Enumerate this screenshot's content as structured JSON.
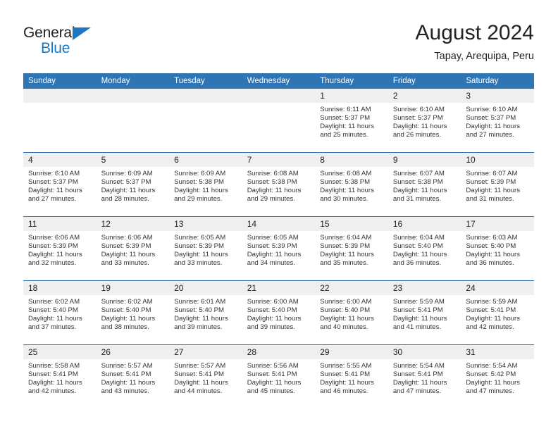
{
  "brand": {
    "name_top": "General",
    "name_bottom": "Blue",
    "triangle_color": "#1b77c4"
  },
  "header": {
    "title": "August 2024",
    "subtitle": "Tapay, Arequipa, Peru"
  },
  "theme": {
    "header_blue": "#2e75b6",
    "daynum_band": "#efefef",
    "text": "#222222"
  },
  "calendar": {
    "weekday_headers": [
      "Sunday",
      "Monday",
      "Tuesday",
      "Wednesday",
      "Thursday",
      "Friday",
      "Saturday"
    ],
    "weeks": [
      [
        {
          "day": "",
          "blank": true,
          "sunrise": "",
          "sunset": "",
          "daylight1": "",
          "daylight2": ""
        },
        {
          "day": "",
          "blank": true,
          "sunrise": "",
          "sunset": "",
          "daylight1": "",
          "daylight2": ""
        },
        {
          "day": "",
          "blank": true,
          "sunrise": "",
          "sunset": "",
          "daylight1": "",
          "daylight2": ""
        },
        {
          "day": "",
          "blank": true,
          "sunrise": "",
          "sunset": "",
          "daylight1": "",
          "daylight2": ""
        },
        {
          "day": "1",
          "blank": false,
          "sunrise": "Sunrise: 6:11 AM",
          "sunset": "Sunset: 5:37 PM",
          "daylight1": "Daylight: 11 hours",
          "daylight2": "and 25 minutes."
        },
        {
          "day": "2",
          "blank": false,
          "sunrise": "Sunrise: 6:10 AM",
          "sunset": "Sunset: 5:37 PM",
          "daylight1": "Daylight: 11 hours",
          "daylight2": "and 26 minutes."
        },
        {
          "day": "3",
          "blank": false,
          "sunrise": "Sunrise: 6:10 AM",
          "sunset": "Sunset: 5:37 PM",
          "daylight1": "Daylight: 11 hours",
          "daylight2": "and 27 minutes."
        }
      ],
      [
        {
          "day": "4",
          "blank": false,
          "sunrise": "Sunrise: 6:10 AM",
          "sunset": "Sunset: 5:37 PM",
          "daylight1": "Daylight: 11 hours",
          "daylight2": "and 27 minutes."
        },
        {
          "day": "5",
          "blank": false,
          "sunrise": "Sunrise: 6:09 AM",
          "sunset": "Sunset: 5:37 PM",
          "daylight1": "Daylight: 11 hours",
          "daylight2": "and 28 minutes."
        },
        {
          "day": "6",
          "blank": false,
          "sunrise": "Sunrise: 6:09 AM",
          "sunset": "Sunset: 5:38 PM",
          "daylight1": "Daylight: 11 hours",
          "daylight2": "and 29 minutes."
        },
        {
          "day": "7",
          "blank": false,
          "sunrise": "Sunrise: 6:08 AM",
          "sunset": "Sunset: 5:38 PM",
          "daylight1": "Daylight: 11 hours",
          "daylight2": "and 29 minutes."
        },
        {
          "day": "8",
          "blank": false,
          "sunrise": "Sunrise: 6:08 AM",
          "sunset": "Sunset: 5:38 PM",
          "daylight1": "Daylight: 11 hours",
          "daylight2": "and 30 minutes."
        },
        {
          "day": "9",
          "blank": false,
          "sunrise": "Sunrise: 6:07 AM",
          "sunset": "Sunset: 5:38 PM",
          "daylight1": "Daylight: 11 hours",
          "daylight2": "and 31 minutes."
        },
        {
          "day": "10",
          "blank": false,
          "sunrise": "Sunrise: 6:07 AM",
          "sunset": "Sunset: 5:39 PM",
          "daylight1": "Daylight: 11 hours",
          "daylight2": "and 31 minutes."
        }
      ],
      [
        {
          "day": "11",
          "blank": false,
          "sunrise": "Sunrise: 6:06 AM",
          "sunset": "Sunset: 5:39 PM",
          "daylight1": "Daylight: 11 hours",
          "daylight2": "and 32 minutes."
        },
        {
          "day": "12",
          "blank": false,
          "sunrise": "Sunrise: 6:06 AM",
          "sunset": "Sunset: 5:39 PM",
          "daylight1": "Daylight: 11 hours",
          "daylight2": "and 33 minutes."
        },
        {
          "day": "13",
          "blank": false,
          "sunrise": "Sunrise: 6:05 AM",
          "sunset": "Sunset: 5:39 PM",
          "daylight1": "Daylight: 11 hours",
          "daylight2": "and 33 minutes."
        },
        {
          "day": "14",
          "blank": false,
          "sunrise": "Sunrise: 6:05 AM",
          "sunset": "Sunset: 5:39 PM",
          "daylight1": "Daylight: 11 hours",
          "daylight2": "and 34 minutes."
        },
        {
          "day": "15",
          "blank": false,
          "sunrise": "Sunrise: 6:04 AM",
          "sunset": "Sunset: 5:39 PM",
          "daylight1": "Daylight: 11 hours",
          "daylight2": "and 35 minutes."
        },
        {
          "day": "16",
          "blank": false,
          "sunrise": "Sunrise: 6:04 AM",
          "sunset": "Sunset: 5:40 PM",
          "daylight1": "Daylight: 11 hours",
          "daylight2": "and 36 minutes."
        },
        {
          "day": "17",
          "blank": false,
          "sunrise": "Sunrise: 6:03 AM",
          "sunset": "Sunset: 5:40 PM",
          "daylight1": "Daylight: 11 hours",
          "daylight2": "and 36 minutes."
        }
      ],
      [
        {
          "day": "18",
          "blank": false,
          "sunrise": "Sunrise: 6:02 AM",
          "sunset": "Sunset: 5:40 PM",
          "daylight1": "Daylight: 11 hours",
          "daylight2": "and 37 minutes."
        },
        {
          "day": "19",
          "blank": false,
          "sunrise": "Sunrise: 6:02 AM",
          "sunset": "Sunset: 5:40 PM",
          "daylight1": "Daylight: 11 hours",
          "daylight2": "and 38 minutes."
        },
        {
          "day": "20",
          "blank": false,
          "sunrise": "Sunrise: 6:01 AM",
          "sunset": "Sunset: 5:40 PM",
          "daylight1": "Daylight: 11 hours",
          "daylight2": "and 39 minutes."
        },
        {
          "day": "21",
          "blank": false,
          "sunrise": "Sunrise: 6:00 AM",
          "sunset": "Sunset: 5:40 PM",
          "daylight1": "Daylight: 11 hours",
          "daylight2": "and 39 minutes."
        },
        {
          "day": "22",
          "blank": false,
          "sunrise": "Sunrise: 6:00 AM",
          "sunset": "Sunset: 5:40 PM",
          "daylight1": "Daylight: 11 hours",
          "daylight2": "and 40 minutes."
        },
        {
          "day": "23",
          "blank": false,
          "sunrise": "Sunrise: 5:59 AM",
          "sunset": "Sunset: 5:41 PM",
          "daylight1": "Daylight: 11 hours",
          "daylight2": "and 41 minutes."
        },
        {
          "day": "24",
          "blank": false,
          "sunrise": "Sunrise: 5:59 AM",
          "sunset": "Sunset: 5:41 PM",
          "daylight1": "Daylight: 11 hours",
          "daylight2": "and 42 minutes."
        }
      ],
      [
        {
          "day": "25",
          "blank": false,
          "sunrise": "Sunrise: 5:58 AM",
          "sunset": "Sunset: 5:41 PM",
          "daylight1": "Daylight: 11 hours",
          "daylight2": "and 42 minutes."
        },
        {
          "day": "26",
          "blank": false,
          "sunrise": "Sunrise: 5:57 AM",
          "sunset": "Sunset: 5:41 PM",
          "daylight1": "Daylight: 11 hours",
          "daylight2": "and 43 minutes."
        },
        {
          "day": "27",
          "blank": false,
          "sunrise": "Sunrise: 5:57 AM",
          "sunset": "Sunset: 5:41 PM",
          "daylight1": "Daylight: 11 hours",
          "daylight2": "and 44 minutes."
        },
        {
          "day": "28",
          "blank": false,
          "sunrise": "Sunrise: 5:56 AM",
          "sunset": "Sunset: 5:41 PM",
          "daylight1": "Daylight: 11 hours",
          "daylight2": "and 45 minutes."
        },
        {
          "day": "29",
          "blank": false,
          "sunrise": "Sunrise: 5:55 AM",
          "sunset": "Sunset: 5:41 PM",
          "daylight1": "Daylight: 11 hours",
          "daylight2": "and 46 minutes."
        },
        {
          "day": "30",
          "blank": false,
          "sunrise": "Sunrise: 5:54 AM",
          "sunset": "Sunset: 5:41 PM",
          "daylight1": "Daylight: 11 hours",
          "daylight2": "and 47 minutes."
        },
        {
          "day": "31",
          "blank": false,
          "sunrise": "Sunrise: 5:54 AM",
          "sunset": "Sunset: 5:42 PM",
          "daylight1": "Daylight: 11 hours",
          "daylight2": "and 47 minutes."
        }
      ]
    ]
  }
}
